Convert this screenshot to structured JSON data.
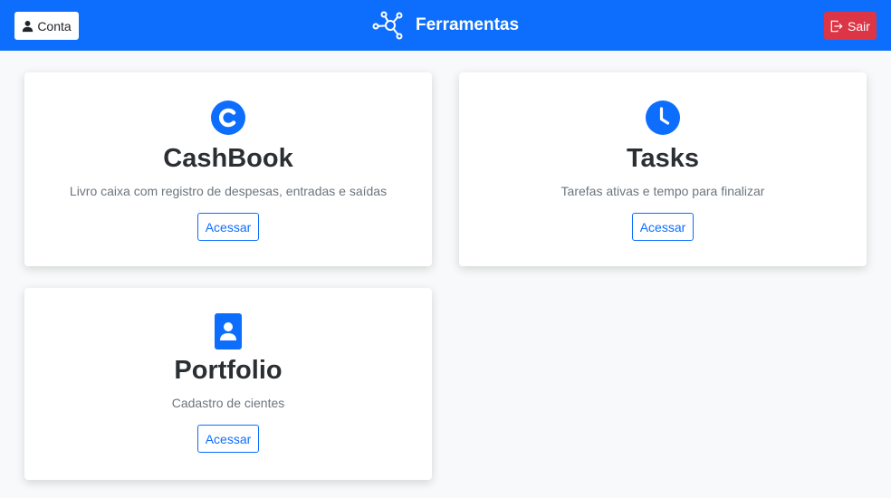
{
  "header": {
    "account_label": "Conta",
    "brand_title": "Ferramentas",
    "logout_label": "Sair",
    "colors": {
      "primary": "#0d6efd",
      "danger": "#dc3545"
    }
  },
  "cards": [
    {
      "icon": "cashbook-c-icon",
      "title": "CashBook",
      "description": "Livro caixa com registro de despesas, entradas e saídas",
      "button": "Acessar"
    },
    {
      "icon": "clock-icon",
      "title": "Tasks",
      "description": "Tarefas ativas e tempo para finalizar",
      "button": "Acessar"
    },
    {
      "icon": "person-badge-icon",
      "title": "Portfolio",
      "description": "Cadastro de cientes",
      "button": "Acessar"
    }
  ]
}
